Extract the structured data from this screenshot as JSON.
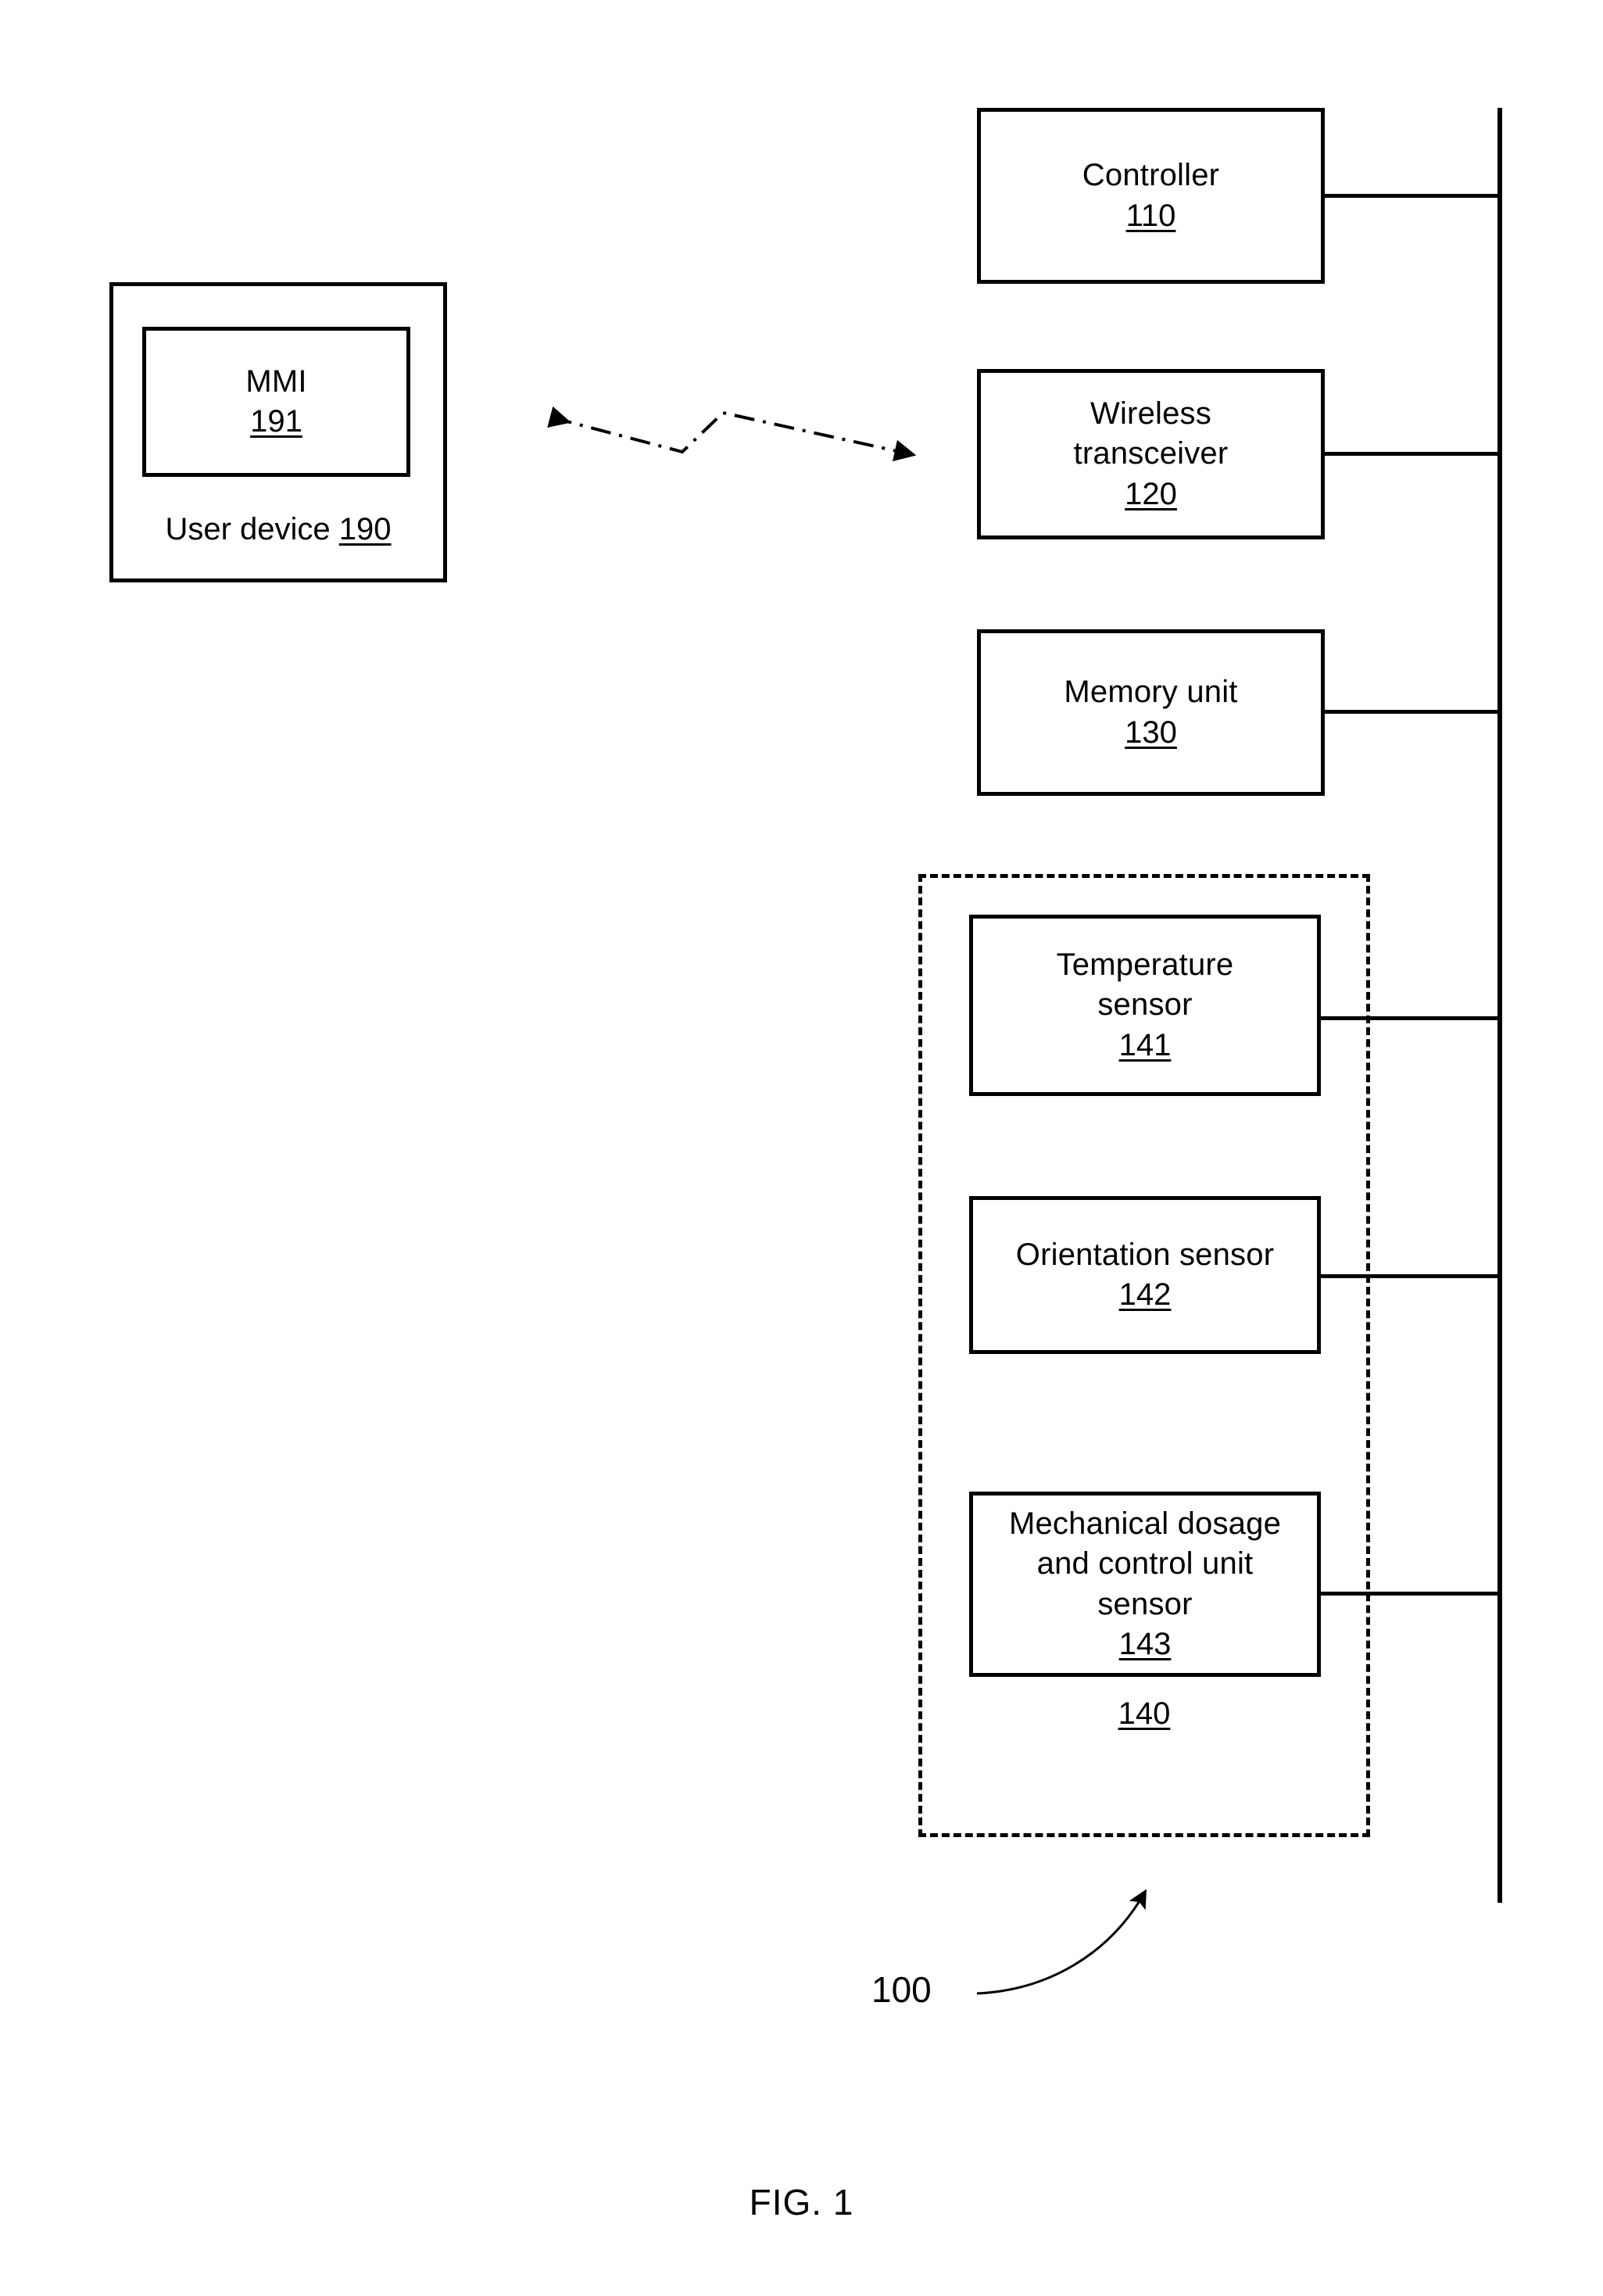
{
  "figure": {
    "caption": "FIG. 1",
    "system_ref": "100"
  },
  "user_device": {
    "caption_text": "User device ",
    "caption_ref": "190",
    "mmi": {
      "label": "MMI",
      "ref": "191"
    }
  },
  "wireless_link": {
    "icon": "bidirectional-wireless-link",
    "style": "dash-dot-zigzag-double-arrow"
  },
  "components": [
    {
      "label": "Controller",
      "ref": "110"
    },
    {
      "label": "Wireless\ntransceiver",
      "ref": "120"
    },
    {
      "label": "Memory unit",
      "ref": "130"
    }
  ],
  "sensor_group": {
    "ref": "140",
    "sensors": [
      {
        "label": "Temperature\nsensor",
        "ref": "141"
      },
      {
        "label": "Orientation sensor",
        "ref": "142"
      },
      {
        "label": "Mechanical dosage\nand control unit\nsensor",
        "ref": "143"
      }
    ]
  },
  "colors": {
    "line": "#000000",
    "background": "#ffffff"
  }
}
